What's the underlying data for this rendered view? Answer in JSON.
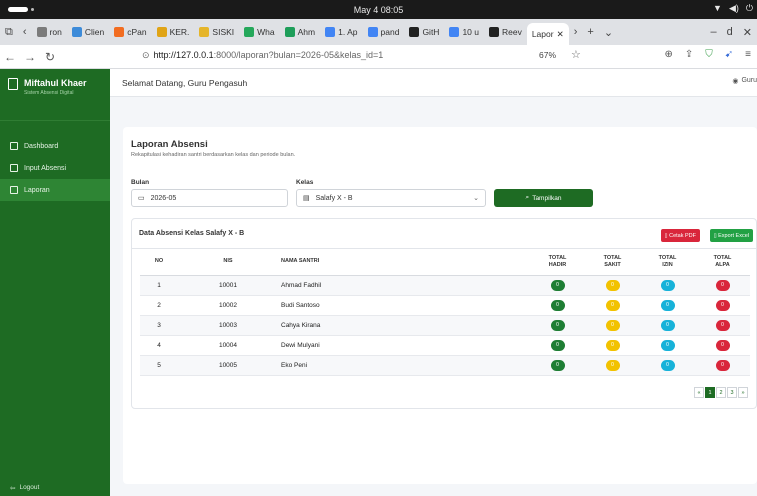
{
  "system": {
    "clock": "May 4  08:05"
  },
  "browser": {
    "tabs": [
      {
        "label": "ron",
        "color": "#7b7b7b"
      },
      {
        "label": "Clien",
        "color": "#3d8bd9"
      },
      {
        "label": "cPan",
        "color": "#f26d21"
      },
      {
        "label": "KER.",
        "color": "#e0a416"
      },
      {
        "label": "SISKI",
        "color": "#e5b52a"
      },
      {
        "label": "Wha",
        "color": "#25a85b"
      },
      {
        "label": "Ahm",
        "color": "#1e9e5a"
      },
      {
        "label": "1. Ap",
        "color": "#4285f4"
      },
      {
        "label": "pand",
        "color": "#4285f4"
      },
      {
        "label": "GitH",
        "color": "#222222"
      },
      {
        "label": "10 u",
        "color": "#4285f4"
      },
      {
        "label": "Reev",
        "color": "#222222"
      }
    ],
    "active_tab": "Lapor",
    "url_host": "http://127.0.0.1",
    "url_rest": ":8000/laporan?bulan=2026-05&kelas_id=1",
    "zoom": "67%"
  },
  "sidebar": {
    "brand_title": "Miftahul Khaer",
    "brand_sub": "Sistem Absensi Digital",
    "items": [
      {
        "label": "Dashboard"
      },
      {
        "label": "Input Absensi"
      },
      {
        "label": "Laporan"
      }
    ],
    "logout": "Logout"
  },
  "topnav": {
    "greeting": "Selamat Datang, Guru Pengasuh",
    "user": "Guru"
  },
  "page": {
    "title": "Laporan Absensi",
    "subtitle": "Rekapitulasi kehadiran santri berdasarkan kelas dan periode bulan.",
    "bulan_label": "Bulan",
    "bulan_value": "2026-05",
    "kelas_label": "Kelas",
    "kelas_value": "Salafy X - B",
    "show_button": "Tampilkan"
  },
  "table": {
    "title": "Data Absensi Kelas Salafy X - B",
    "pdf_button": "Cetak PDF",
    "excel_button": "Export Excel",
    "headers": {
      "no": "NO",
      "nis": "NIS",
      "nama": "NAMA SANTRI",
      "hadir": [
        "TOTAL",
        "HADIR"
      ],
      "sakit": [
        "TOTAL",
        "SAKIT"
      ],
      "izin": [
        "TOTAL",
        "IZIN"
      ],
      "alpa": [
        "TOTAL",
        "ALPA"
      ]
    },
    "rows": [
      {
        "no": "1",
        "nis": "10001",
        "nama": "Ahmad Fadhil",
        "hadir": "0",
        "sakit": "0",
        "izin": "0",
        "alpa": "0"
      },
      {
        "no": "2",
        "nis": "10002",
        "nama": "Budi Santoso",
        "hadir": "0",
        "sakit": "0",
        "izin": "0",
        "alpa": "0"
      },
      {
        "no": "3",
        "nis": "10003",
        "nama": "Cahya Kirana",
        "hadir": "0",
        "sakit": "0",
        "izin": "0",
        "alpa": "0"
      },
      {
        "no": "4",
        "nis": "10004",
        "nama": "Dewi Mulyani",
        "hadir": "0",
        "sakit": "0",
        "izin": "0",
        "alpa": "0"
      },
      {
        "no": "5",
        "nis": "10005",
        "nama": "Eko Peni",
        "hadir": "0",
        "sakit": "0",
        "izin": "0",
        "alpa": "0"
      }
    ],
    "badge_colors": {
      "hadir": "#1e7e34",
      "sakit": "#f2c200",
      "izin": "#17b2d9",
      "alpa": "#d9263b"
    },
    "pager": [
      "«",
      "1",
      "2",
      "3",
      "»"
    ]
  }
}
